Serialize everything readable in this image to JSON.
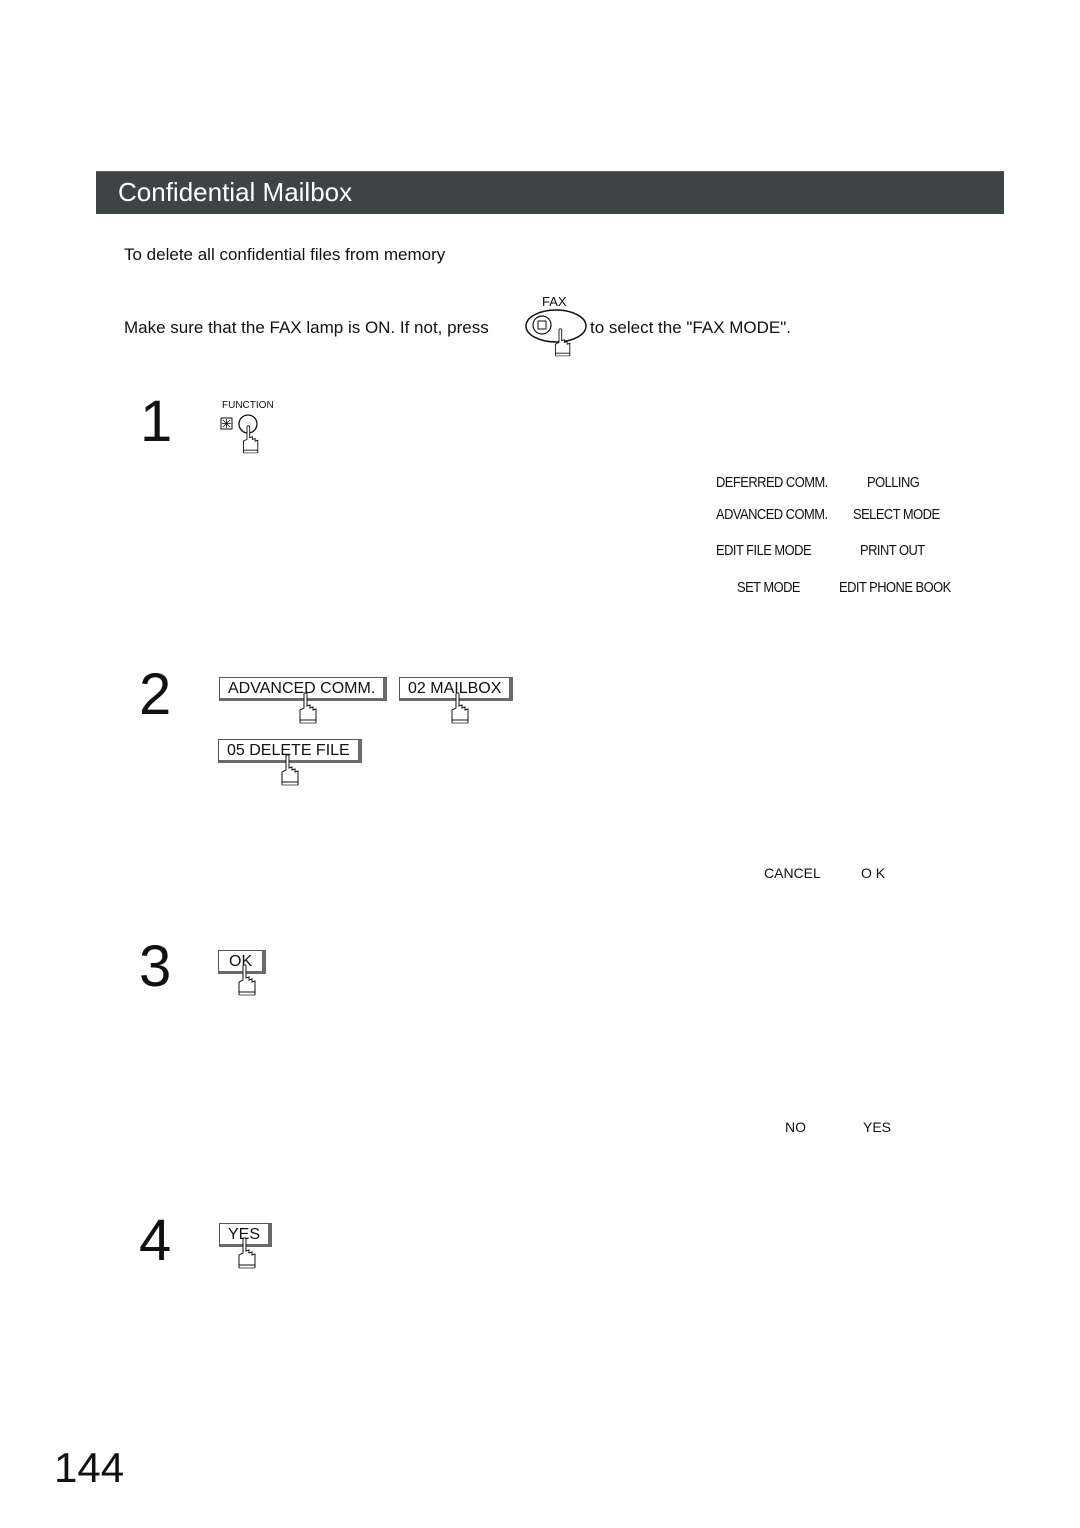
{
  "section": {
    "title": "Confidential Mailbox",
    "subtitle": "To delete all confidential files from memory"
  },
  "intro": {
    "before_key": "Make sure that the FAX lamp is ON.  If not, press",
    "key_label": "FAX",
    "after_key": "to select the \"FAX MODE\"."
  },
  "steps": [
    {
      "number": "1",
      "key_label": "FUNCTION",
      "display": [
        [
          "DEFERRED COMM.",
          "POLLING"
        ],
        [
          "ADVANCED COMM.",
          "SELECT MODE"
        ],
        [
          "EDIT FILE MODE",
          "PRINT OUT"
        ],
        [
          "SET MODE",
          "EDIT PHONE BOOK"
        ]
      ]
    },
    {
      "number": "2",
      "buttons": [
        "ADVANCED COMM.",
        "02 MAILBOX",
        "05 DELETE FILE"
      ],
      "display": [
        "CANCEL",
        "O K"
      ]
    },
    {
      "number": "3",
      "buttons": [
        "OK"
      ],
      "display": [
        "NO",
        "YES"
      ]
    },
    {
      "number": "4",
      "buttons": [
        "YES"
      ]
    }
  ],
  "page_number": "144"
}
